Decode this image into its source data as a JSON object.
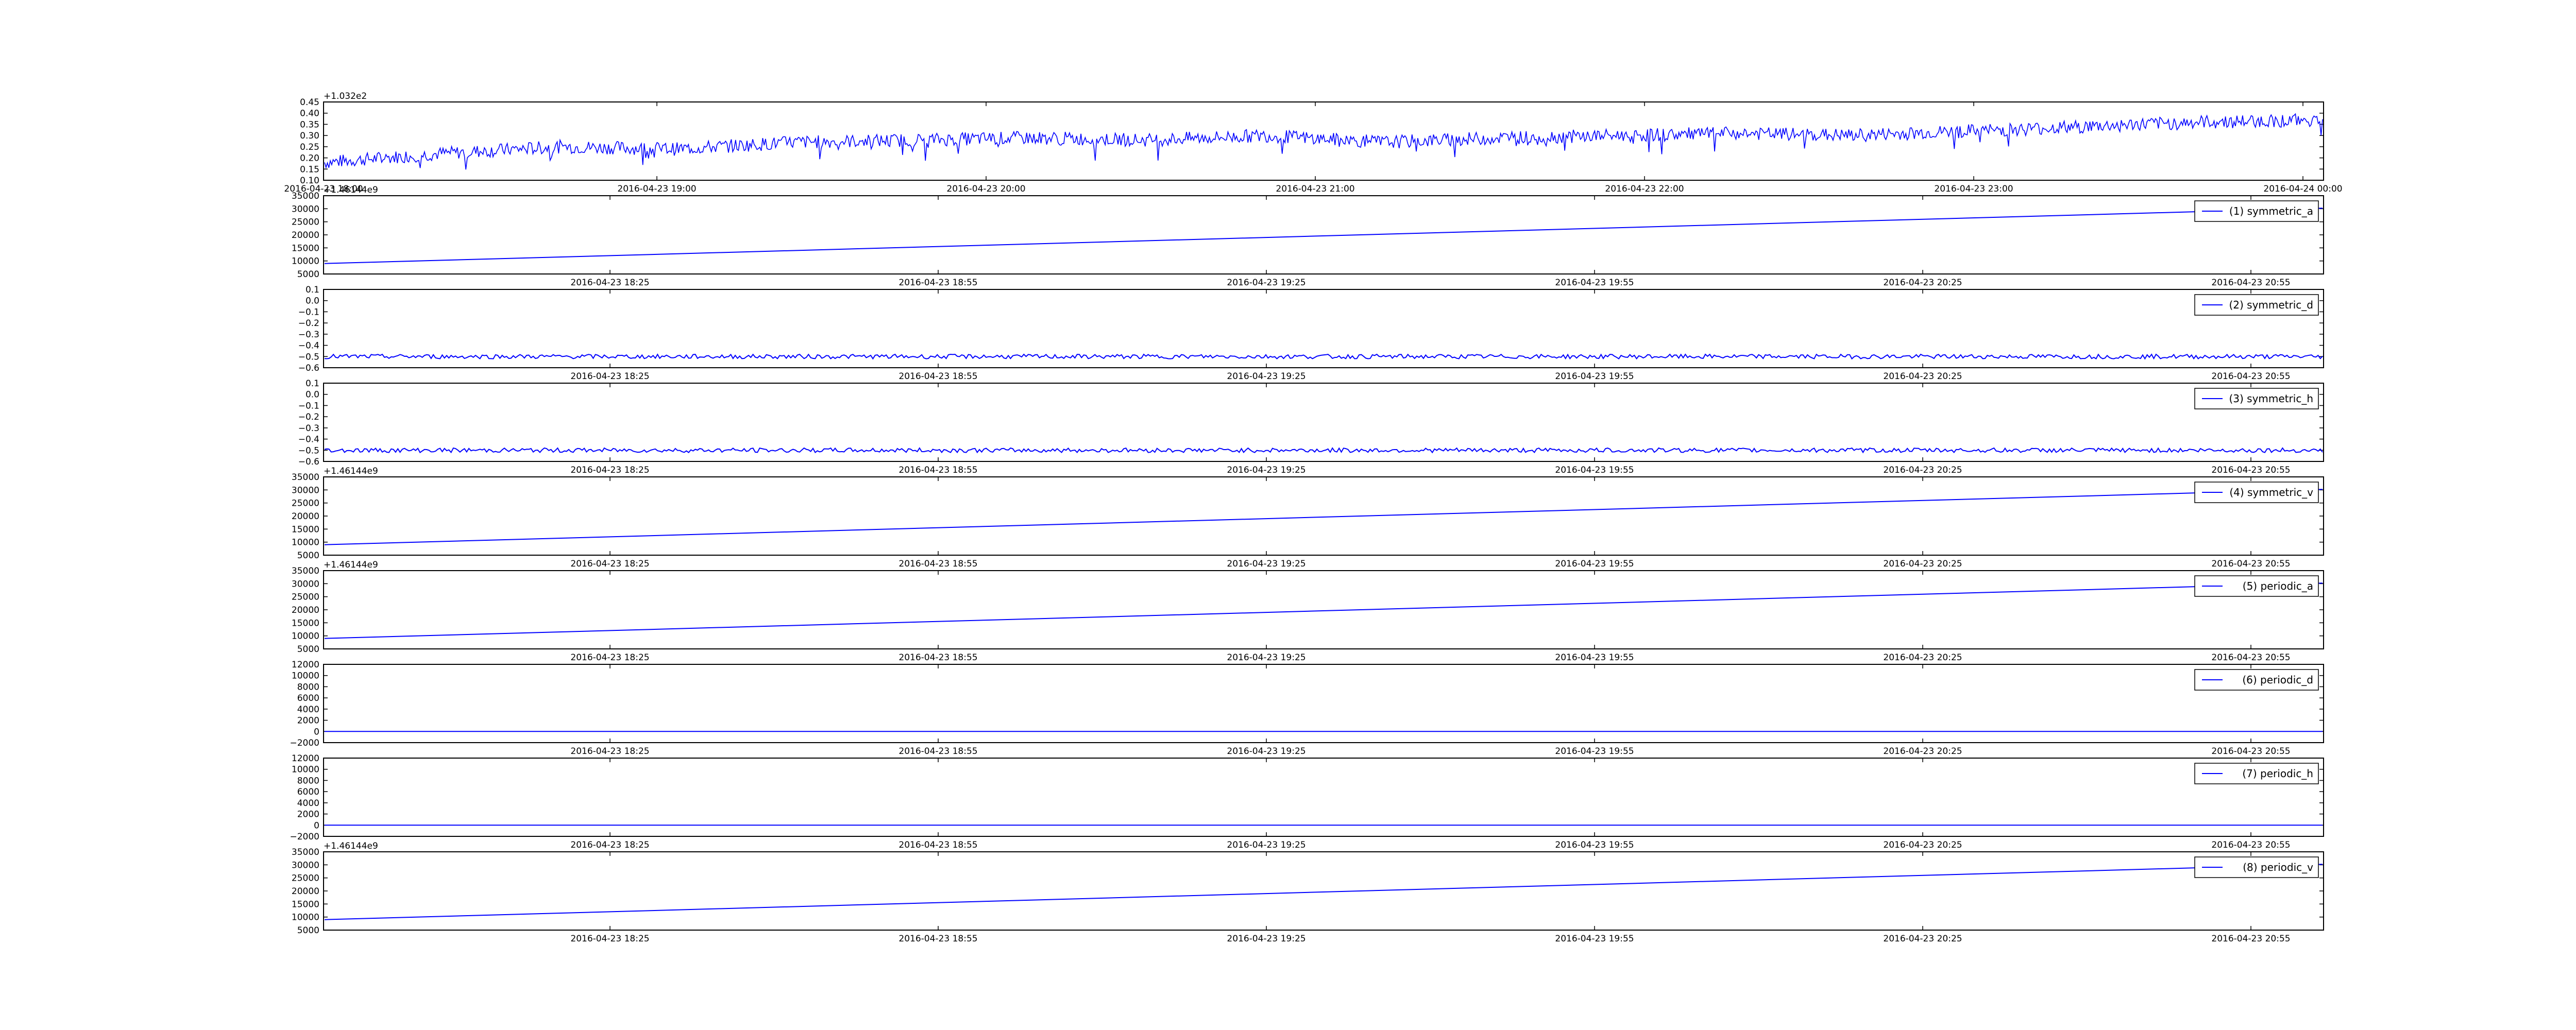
{
  "chart_data": [
    {
      "type": "line",
      "offset_label": "+1.032e2",
      "yticks": [
        "0.10",
        "0.15",
        "0.20",
        "0.25",
        "0.30",
        "0.35",
        "0.40",
        "0.45"
      ],
      "ylim": [
        0.1,
        0.45
      ],
      "xticks": [
        "2016-04-23 18:00",
        "2016-04-23 19:00",
        "2016-04-23 20:00",
        "2016-04-23 21:00",
        "2016-04-23 22:00",
        "2016-04-23 23:00",
        "2016-04-24 00:00"
      ],
      "legend": "",
      "series": [
        {
          "color": "#0000ff",
          "x": [
            "2016-04-23 18:00",
            "2016-04-24 00:00"
          ],
          "trend": [
            0.18,
            0.22,
            0.25,
            0.24,
            0.27,
            0.28,
            0.29,
            0.28,
            0.3,
            0.27,
            0.29,
            0.3,
            0.31,
            0.3,
            0.32,
            0.34,
            0.36,
            0.37
          ],
          "noise": 0.03
        }
      ]
    },
    {
      "type": "line",
      "offset_label": "+1.46144e9",
      "yticks": [
        "5000",
        "10000",
        "15000",
        "20000",
        "25000",
        "30000",
        "35000"
      ],
      "ylim": [
        5000,
        35000
      ],
      "xticks": [
        "2016-04-23 18:25",
        "2016-04-23 18:55",
        "2016-04-23 19:25",
        "2016-04-23 19:55",
        "2016-04-23 20:25",
        "2016-04-23 20:55"
      ],
      "legend": "(1) symmetric_a",
      "series": [
        {
          "color": "#0000ff",
          "name": "(1) symmetric_a",
          "y_start": 9000,
          "y_end": 30200,
          "noise": 0
        }
      ]
    },
    {
      "type": "line",
      "offset_label": "",
      "yticks": [
        "−0.6",
        "−0.5",
        "−0.4",
        "−0.3",
        "−0.2",
        "−0.1",
        "0.0",
        "0.1"
      ],
      "ylim": [
        -0.6,
        0.1
      ],
      "xticks": [
        "2016-04-23 18:25",
        "2016-04-23 18:55",
        "2016-04-23 19:25",
        "2016-04-23 19:55",
        "2016-04-23 20:25",
        "2016-04-23 20:55"
      ],
      "legend": "(2) symmetric_d",
      "series": [
        {
          "color": "#0000ff",
          "name": "(2) symmetric_d",
          "y_start": -0.5,
          "y_end": -0.5,
          "noise": 0.02
        }
      ]
    },
    {
      "type": "line",
      "offset_label": "",
      "yticks": [
        "−0.6",
        "−0.5",
        "−0.4",
        "−0.3",
        "−0.2",
        "−0.1",
        "0.0",
        "0.1"
      ],
      "ylim": [
        -0.6,
        0.1
      ],
      "xticks": [
        "2016-04-23 18:25",
        "2016-04-23 18:55",
        "2016-04-23 19:25",
        "2016-04-23 19:55",
        "2016-04-23 20:25",
        "2016-04-23 20:55"
      ],
      "legend": "(3) symmetric_h",
      "series": [
        {
          "color": "#0000ff",
          "name": "(3) symmetric_h",
          "y_start": -0.5,
          "y_end": -0.5,
          "noise": 0.02
        }
      ]
    },
    {
      "type": "line",
      "offset_label": "+1.46144e9",
      "yticks": [
        "5000",
        "10000",
        "15000",
        "20000",
        "25000",
        "30000",
        "35000"
      ],
      "ylim": [
        5000,
        35000
      ],
      "xticks": [
        "2016-04-23 18:25",
        "2016-04-23 18:55",
        "2016-04-23 19:25",
        "2016-04-23 19:55",
        "2016-04-23 20:25",
        "2016-04-23 20:55"
      ],
      "legend": "(4) symmetric_v",
      "series": [
        {
          "color": "#0000ff",
          "name": "(4) symmetric_v",
          "y_start": 9000,
          "y_end": 30200,
          "noise": 0
        }
      ]
    },
    {
      "type": "line",
      "offset_label": "+1.46144e9",
      "yticks": [
        "5000",
        "10000",
        "15000",
        "20000",
        "25000",
        "30000",
        "35000"
      ],
      "ylim": [
        5000,
        35000
      ],
      "xticks": [
        "2016-04-23 18:25",
        "2016-04-23 18:55",
        "2016-04-23 19:25",
        "2016-04-23 19:55",
        "2016-04-23 20:25",
        "2016-04-23 20:55"
      ],
      "legend": "(5) periodic_a",
      "series": [
        {
          "color": "#0000ff",
          "name": "(5) periodic_a",
          "y_start": 9000,
          "y_end": 30200,
          "noise": 0
        }
      ]
    },
    {
      "type": "line",
      "offset_label": "",
      "yticks": [
        "−2000",
        "0",
        "2000",
        "4000",
        "6000",
        "8000",
        "10000",
        "12000"
      ],
      "ylim": [
        -2000,
        12000
      ],
      "xticks": [
        "2016-04-23 18:25",
        "2016-04-23 18:55",
        "2016-04-23 19:25",
        "2016-04-23 19:55",
        "2016-04-23 20:25",
        "2016-04-23 20:55"
      ],
      "legend": "(6) periodic_d",
      "series": [
        {
          "color": "#0000ff",
          "name": "(6) periodic_d",
          "y_start": 0,
          "y_end": 0,
          "noise": 0
        }
      ]
    },
    {
      "type": "line",
      "offset_label": "",
      "yticks": [
        "−2000",
        "0",
        "2000",
        "4000",
        "6000",
        "8000",
        "10000",
        "12000"
      ],
      "ylim": [
        -2000,
        12000
      ],
      "xticks": [
        "2016-04-23 18:25",
        "2016-04-23 18:55",
        "2016-04-23 19:25",
        "2016-04-23 19:55",
        "2016-04-23 20:25",
        "2016-04-23 20:55"
      ],
      "legend": "(7) periodic_h",
      "series": [
        {
          "color": "#0000ff",
          "name": "(7) periodic_h",
          "y_start": 0,
          "y_end": 0,
          "noise": 0
        }
      ]
    },
    {
      "type": "line",
      "offset_label": "+1.46144e9",
      "yticks": [
        "5000",
        "10000",
        "15000",
        "20000",
        "25000",
        "30000",
        "35000"
      ],
      "ylim": [
        5000,
        35000
      ],
      "xticks": [
        "2016-04-23 18:25",
        "2016-04-23 18:55",
        "2016-04-23 19:25",
        "2016-04-23 19:55",
        "2016-04-23 20:25",
        "2016-04-23 20:55"
      ],
      "legend": "(8) periodic_v",
      "series": [
        {
          "color": "#0000ff",
          "name": "(8) periodic_v",
          "y_start": 9000,
          "y_end": 30200,
          "noise": 0
        }
      ]
    }
  ]
}
